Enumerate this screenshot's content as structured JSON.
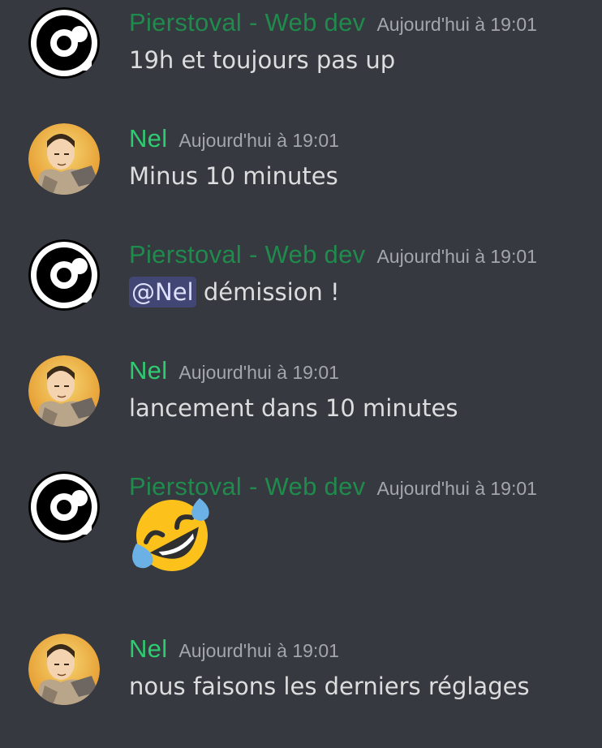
{
  "messages": [
    {
      "author": "Pierstoval - Web dev",
      "author_kind": "pierstoval",
      "timestamp": "Aujourd'hui à 19:01",
      "text": "19h et toujours pas up"
    },
    {
      "author": "Nel",
      "author_kind": "nel",
      "timestamp": "Aujourd'hui à 19:01",
      "text": "Minus 10 minutes"
    },
    {
      "author": "Pierstoval - Web dev",
      "author_kind": "pierstoval",
      "timestamp": "Aujourd'hui à 19:01",
      "mention": "@Nel",
      "text": "démission !"
    },
    {
      "author": "Nel",
      "author_kind": "nel",
      "timestamp": "Aujourd'hui à 19:01",
      "text": "lancement dans 10 minutes"
    },
    {
      "author": "Pierstoval - Web dev",
      "author_kind": "pierstoval",
      "timestamp": "Aujourd'hui à 19:01",
      "emoji": "rolling-on-the-floor-laughing-emoji"
    },
    {
      "author": "Nel",
      "author_kind": "nel",
      "timestamp": "Aujourd'hui à 19:01",
      "text": "nous faisons les derniers réglages"
    }
  ],
  "colors": {
    "background": "#36393f",
    "pierstoval_name": "#1f8b4c",
    "nel_name": "#2ecc71",
    "timestamp": "#a3a6aa",
    "text": "#dcddde",
    "mention_bg": "#414675"
  },
  "icons": {
    "pierstoval_avatar": "pierstoval-logo-avatar",
    "nel_avatar": "nel-portrait-avatar"
  }
}
